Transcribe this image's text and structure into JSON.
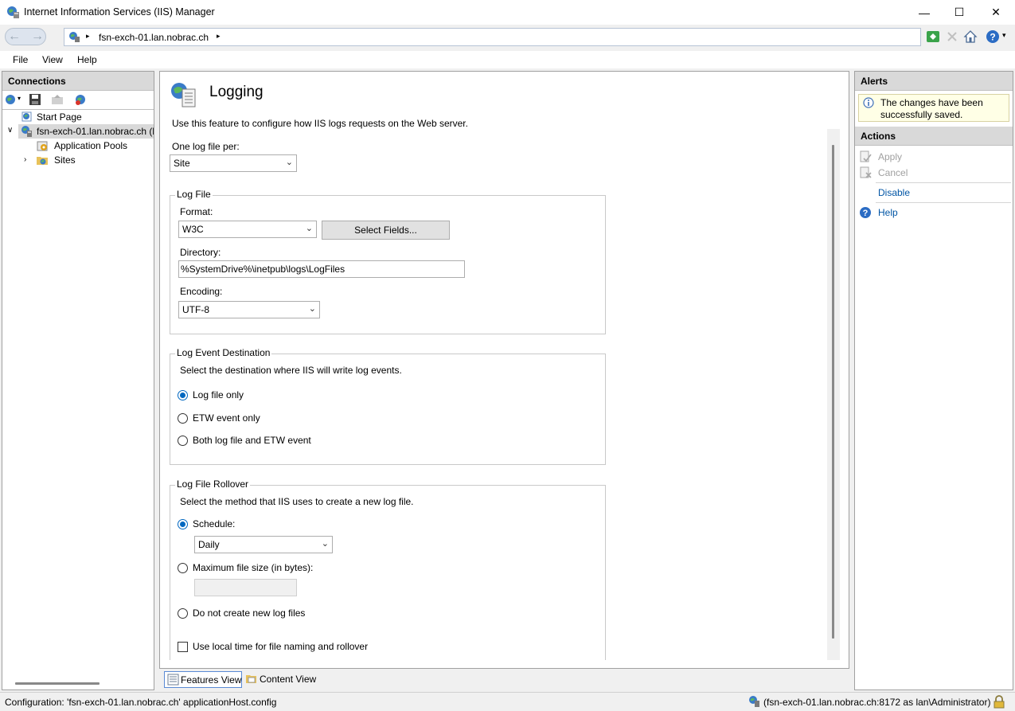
{
  "window": {
    "title": "Internet Information Services (IIS) Manager",
    "minimize": "—",
    "maximize": "☐",
    "close": "✕"
  },
  "address": {
    "path": "fsn-exch-01.lan.nobrac.ch",
    "sep1": "▸",
    "sep2": "▸"
  },
  "menu": {
    "file": "File",
    "view": "View",
    "help": "Help"
  },
  "connections": {
    "header": "Connections",
    "tree": {
      "start_page": "Start Page",
      "server": "fsn-exch-01.lan.nobrac.ch (l",
      "app_pools": "Application Pools",
      "sites": "Sites"
    }
  },
  "main": {
    "title": "Logging",
    "description": "Use this feature to configure how IIS logs requests on the Web server.",
    "one_log_file_label": "One log file per:",
    "one_log_file_value": "Site",
    "log_file": {
      "legend": "Log File",
      "format_label": "Format:",
      "format_value": "W3C",
      "select_fields": "Select Fields...",
      "directory_label": "Directory:",
      "directory_value": "%SystemDrive%\\inetpub\\logs\\LogFiles",
      "encoding_label": "Encoding:",
      "encoding_value": "UTF-8"
    },
    "log_event_destination": {
      "legend": "Log Event Destination",
      "description": "Select the destination where IIS will write log events.",
      "options": [
        "Log file only",
        "ETW event only",
        "Both log file and ETW event"
      ],
      "selected": 0
    },
    "log_file_rollover": {
      "legend": "Log File Rollover",
      "description": "Select the method that IIS uses to create a new log file.",
      "schedule_label": "Schedule:",
      "schedule_value": "Daily",
      "max_size_label": "Maximum file size (in bytes):",
      "max_size_value": "",
      "no_new_label": "Do not create new log files",
      "local_time_label": "Use local time for file naming and rollover"
    }
  },
  "alerts": {
    "header": "Alerts",
    "message_line1": "The changes have been",
    "message_line2": "successfully saved."
  },
  "actions": {
    "header": "Actions",
    "apply": "Apply",
    "cancel": "Cancel",
    "disable": "Disable",
    "help": "Help"
  },
  "view_tabs": {
    "features": "Features View",
    "content": "Content View"
  },
  "status": {
    "left": "Configuration: 'fsn-exch-01.lan.nobrac.ch' applicationHost.config",
    "right": "(fsn-exch-01.lan.nobrac.ch:8172 as lan\\Administrator)"
  },
  "colors": {
    "accent": "#0067c0",
    "link": "#0055a5",
    "alert_bg": "#ffffe6",
    "pane_header": "#d9d9d9"
  }
}
